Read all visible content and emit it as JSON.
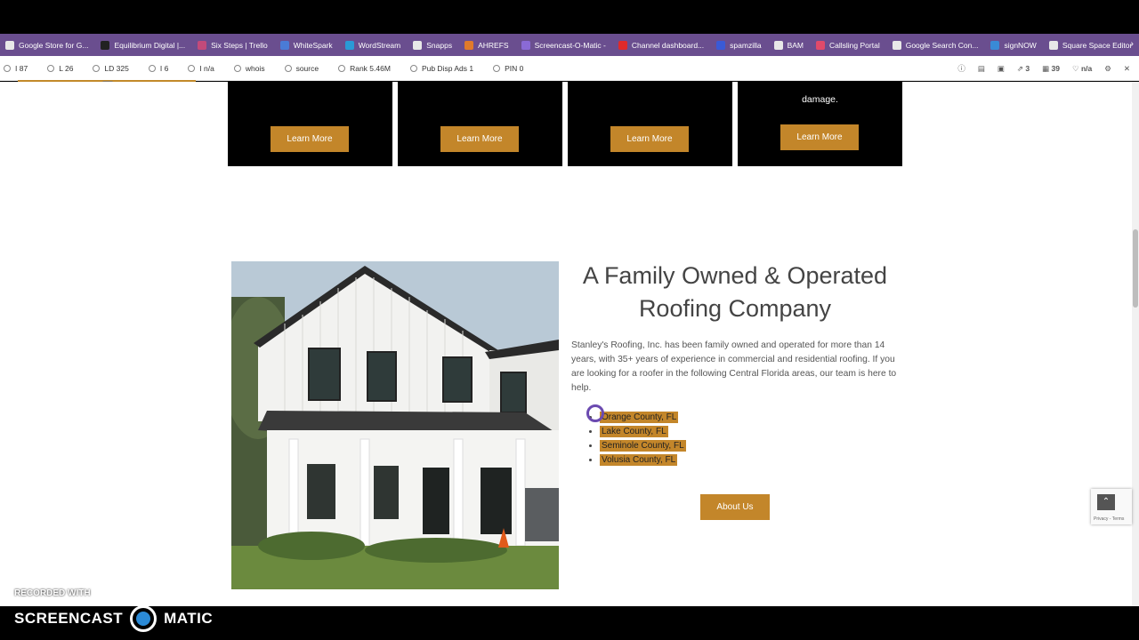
{
  "bookmarks": [
    {
      "label": "Google Store for G...",
      "color": "#e8e8e8"
    },
    {
      "label": "Equilibrium Digital |...",
      "color": "#222222"
    },
    {
      "label": "Six Steps | Trello",
      "color": "#c24a7a"
    },
    {
      "label": "WhiteSpark",
      "color": "#4a7bd6"
    },
    {
      "label": "WordStream",
      "color": "#2a9ad6"
    },
    {
      "label": "Snapps",
      "color": "#e8e8e8"
    },
    {
      "label": "AHREFS",
      "color": "#e07a2a"
    },
    {
      "label": "Screencast-O-Matic -",
      "color": "#8a6ad6"
    },
    {
      "label": "Channel dashboard...",
      "color": "#e02a2a"
    },
    {
      "label": "spamzilla",
      "color": "#3a5ad6"
    },
    {
      "label": "BAM",
      "color": "#e8e8e8"
    },
    {
      "label": "Callsling Portal",
      "color": "#e04a6a"
    },
    {
      "label": "Google Search Con...",
      "color": "#e8e8e8"
    },
    {
      "label": "signNOW",
      "color": "#3a8ad6"
    },
    {
      "label": "Square Space Editor",
      "color": "#e8e8e8"
    }
  ],
  "seo_bar": {
    "items": [
      {
        "label": "I 87",
        "icon": "google-icon"
      },
      {
        "label": "L 26",
        "icon": "link-icon"
      },
      {
        "label": "LD 325",
        "icon": "link-domain-icon"
      },
      {
        "label": "I 6",
        "icon": "bing-icon"
      },
      {
        "label": "I n/a",
        "icon": "facebook-icon"
      },
      {
        "label": "whois",
        "icon": "person-icon"
      },
      {
        "label": "source",
        "icon": "code-icon"
      },
      {
        "label": "Rank 5.46M",
        "icon": "rank-icon"
      },
      {
        "label": "Pub Disp Ads 1",
        "icon": "ads-icon"
      },
      {
        "label": "PIN 0",
        "icon": "pinterest-icon"
      }
    ],
    "right": [
      "3",
      "39",
      "n/a"
    ]
  },
  "services": [
    {
      "snippet": "",
      "button": "Learn More"
    },
    {
      "snippet": "",
      "button": "Learn More"
    },
    {
      "snippet": "",
      "button": "Learn More"
    },
    {
      "snippet": "damage.",
      "button": "Learn More"
    }
  ],
  "about": {
    "heading": "A Family Owned & Operated Roofing Company",
    "paragraph": "Stanley's Roofing, Inc. has been family owned and operated for more than 14 years, with 35+ years of experience in commercial and residential roofing. If you are looking for a roofer in the following Central Florida areas, our team is here to help.",
    "counties": [
      "Orange County, FL",
      "Lake County, FL",
      "Seminole County, FL",
      "Volusia County, FL"
    ],
    "button": "About Us"
  },
  "recaptcha": {
    "text": "Privacy - Terms"
  },
  "watermark": {
    "recorded_with": "RECORDED WITH",
    "brand_left": "SCREENCAST",
    "brand_right": "MATIC"
  }
}
